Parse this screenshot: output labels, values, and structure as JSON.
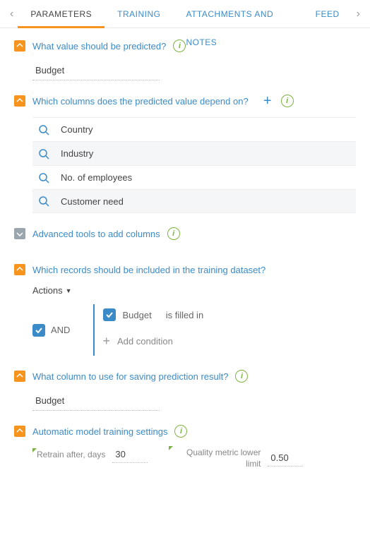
{
  "tabs": {
    "t0": "PARAMETERS",
    "t1": "TRAINING",
    "t2": "ATTACHMENTS AND NOTES",
    "t3": "FEED"
  },
  "s1": {
    "title": "What value should be predicted?",
    "value": "Budget"
  },
  "s2": {
    "title": "Which columns does the predicted value depend on?",
    "cols": {
      "c0": "Country",
      "c1": "Industry",
      "c2": "No. of employees",
      "c3": "Customer need"
    }
  },
  "s3": {
    "title": "Advanced tools to add columns"
  },
  "s4": {
    "title": "Which records should be included in the training dataset?",
    "actions": "Actions",
    "and": "AND",
    "cond_field": "Budget",
    "cond_op": "is filled in",
    "add": "Add condition"
  },
  "s5": {
    "title": "What column to use for saving prediction result?",
    "value": "Budget"
  },
  "s6": {
    "title": "Automatic model training settings",
    "retrain_label": "Retrain after, days",
    "retrain_value": "30",
    "quality_label": "Quality metric lower limit",
    "quality_value": "0.50"
  }
}
